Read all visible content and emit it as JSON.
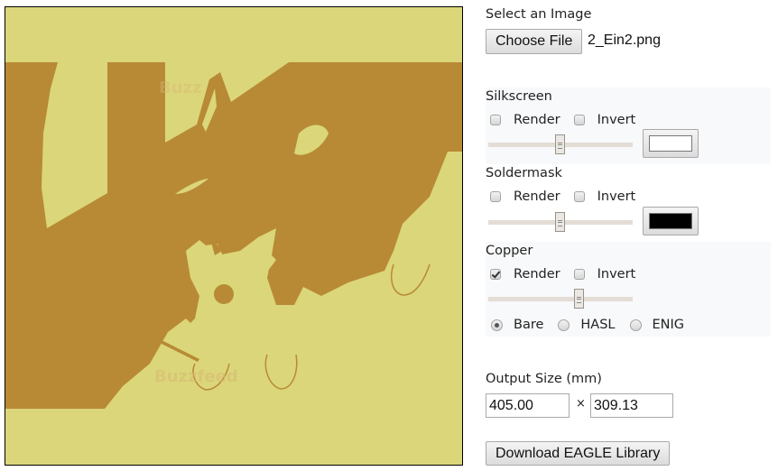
{
  "preview": {
    "background_color": "#dbd67a",
    "copper_color": "#b88a35",
    "watermark_top": "Buzz",
    "watermark_bottom": "Buzzfeed"
  },
  "file": {
    "section_label": "Select an Image",
    "choose_button": "Choose File",
    "filename": "2_Ein2.png"
  },
  "layers": [
    {
      "name": "Silkscreen",
      "render_label": "Render",
      "render_checked": false,
      "invert_label": "Invert",
      "invert_checked": false,
      "threshold": 0.5,
      "color": "#ffffff"
    },
    {
      "name": "Soldermask",
      "render_label": "Render",
      "render_checked": false,
      "invert_label": "Invert",
      "invert_checked": false,
      "threshold": 0.5,
      "color": "#000000"
    },
    {
      "name": "Copper",
      "render_label": "Render",
      "render_checked": true,
      "invert_label": "Invert",
      "invert_checked": false,
      "threshold": 0.63,
      "finish_options": [
        "Bare",
        "HASL",
        "ENIG"
      ],
      "finish_selected": "Bare"
    }
  ],
  "output": {
    "label": "Output Size (mm)",
    "width": "405.00",
    "separator": "×",
    "height": "309.13"
  },
  "download_button": "Download EAGLE Library"
}
